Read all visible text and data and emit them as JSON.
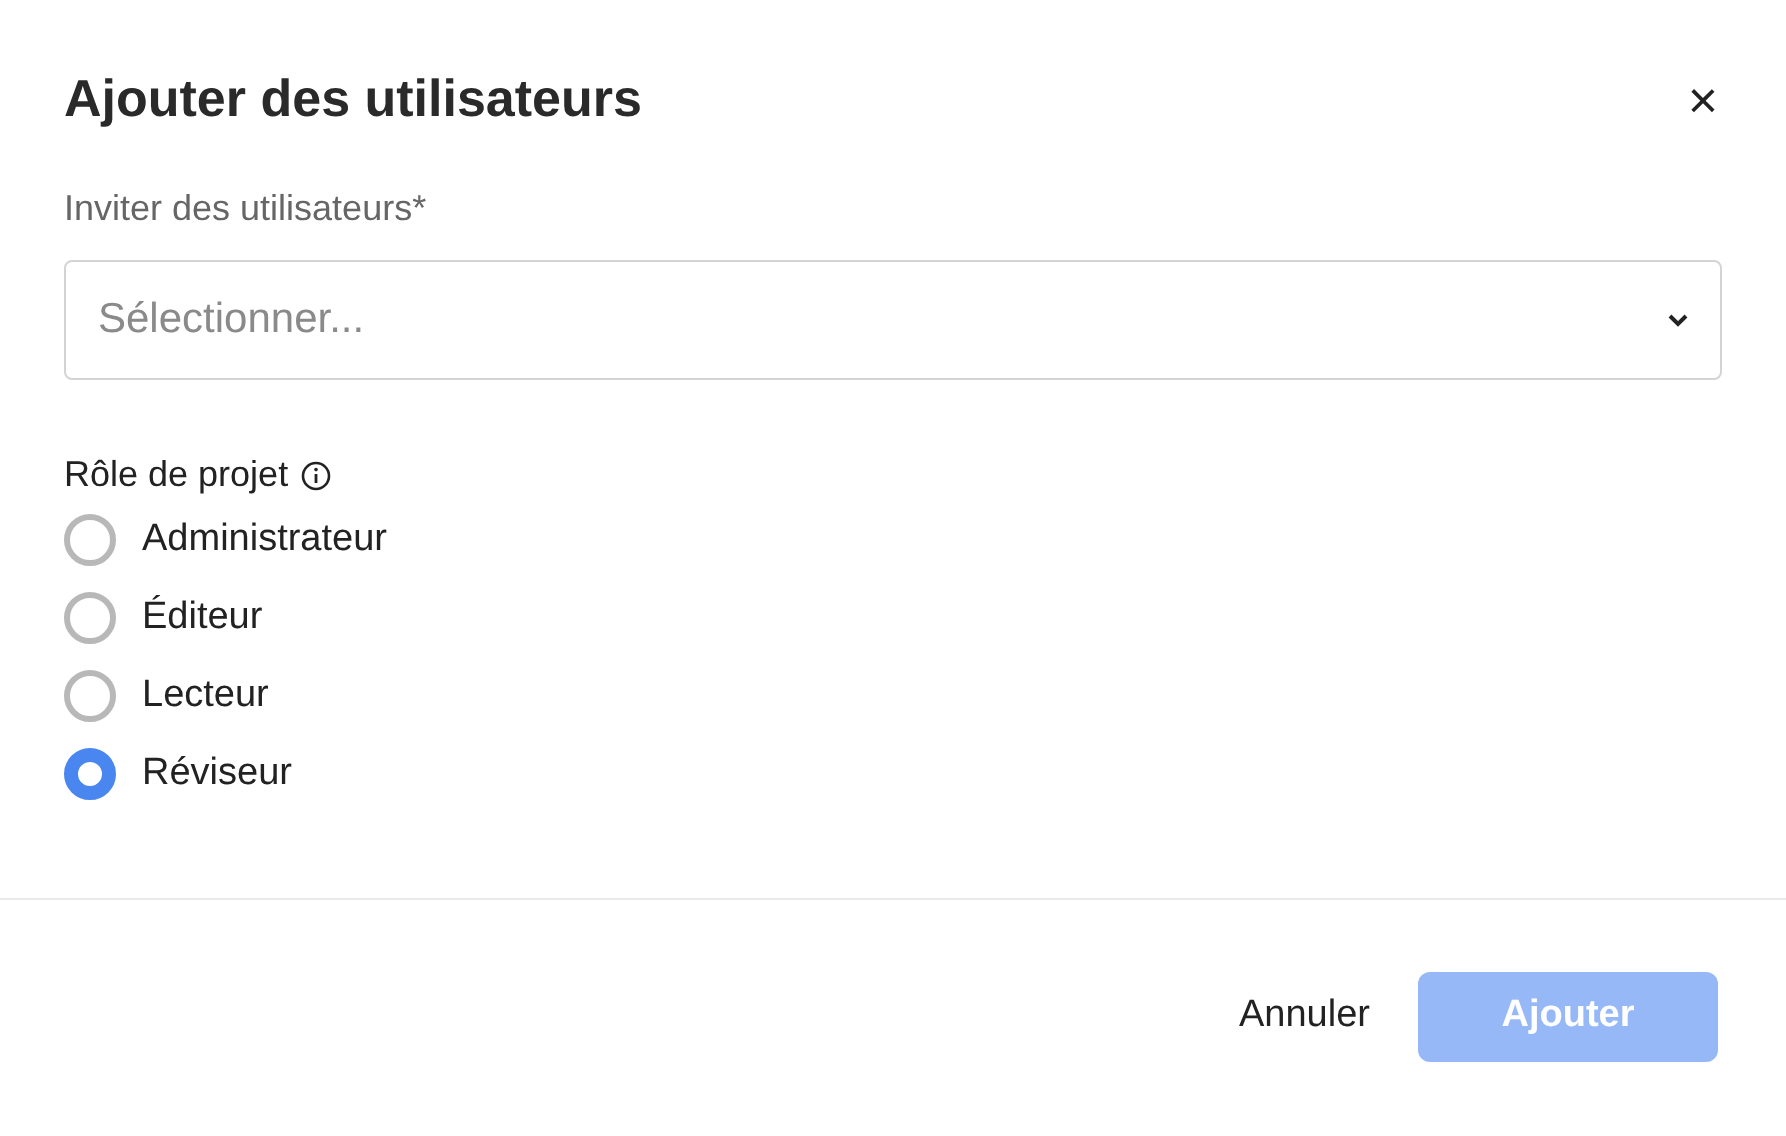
{
  "dialog": {
    "title": "Ajouter des utilisateurs",
    "close": "×"
  },
  "invite": {
    "label": "Inviter des utilisateurs*",
    "placeholder": "Sélectionner..."
  },
  "role": {
    "label": "Rôle de projet",
    "options": [
      {
        "label": "Administrateur",
        "selected": false
      },
      {
        "label": "Éditeur",
        "selected": false
      },
      {
        "label": "Lecteur",
        "selected": false
      },
      {
        "label": "Réviseur",
        "selected": true
      }
    ]
  },
  "buttons": {
    "cancel": {
      "label": "Annuler"
    },
    "submit": {
      "label": "Ajouter",
      "disabled": true
    }
  }
}
